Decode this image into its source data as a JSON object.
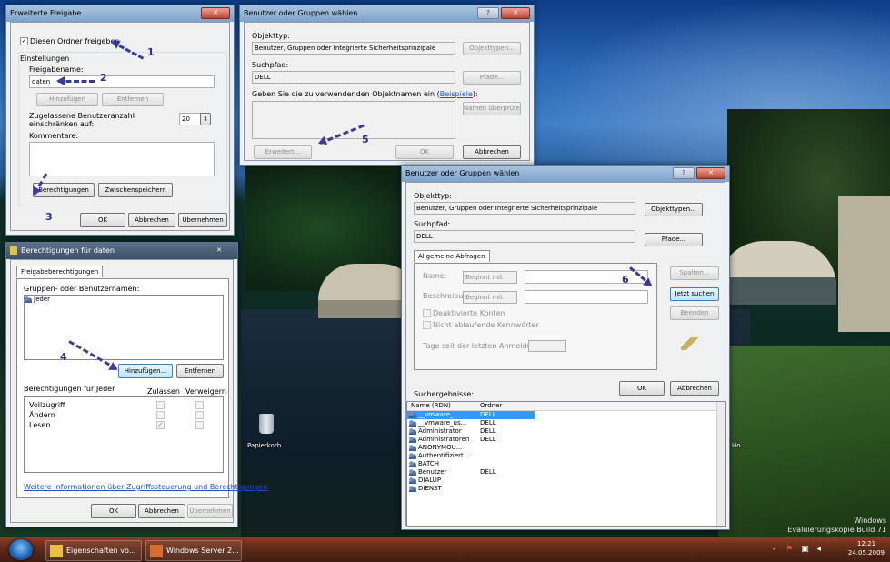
{
  "desktop": {
    "watermark_line1": "Windows",
    "watermark_line2": "Evaluierungskopie Build 71",
    "recycle_bin_label": "Papierkorb",
    "ho_label": "Ho..."
  },
  "win_freigabe": {
    "title": "Erweiterte Freigabe",
    "share_checkbox_label": "Diesen Ordner freigeben",
    "share_checked": true,
    "settings_group": "Einstellungen",
    "share_name_label": "Freigabename:",
    "share_name_value": "daten",
    "add_button": "Hinzufügen",
    "remove_button": "Entfernen",
    "limit_label": "Zugelassene Benutzeranzahl einschränken auf:",
    "limit_value": "20",
    "comments_label": "Kommentare:",
    "permissions_button": "Berechtigungen",
    "caching_button": "Zwischenspeichern",
    "ok": "OK",
    "cancel": "Abbrechen",
    "apply": "Übernehmen"
  },
  "win_select_small": {
    "title": "Benutzer oder Gruppen wählen",
    "object_type_label": "Objekttyp:",
    "object_type_value": "Benutzer, Gruppen oder Integrierte Sicherheitsprinzipale",
    "object_types_button": "Objekttypen...",
    "location_label": "Suchpfad:",
    "location_value": "DELL",
    "paths_button": "Pfade...",
    "names_label": "Geben Sie die zu verwendenden Objektnamen ein",
    "names_link": "Beispiele",
    "check_names_button": "Namen überprüfen",
    "advanced_button": "Erweitert...",
    "ok": "OK",
    "cancel": "Abbrechen"
  },
  "win_permissions": {
    "title": "Berechtigungen für daten",
    "tab": "Freigabeberechtigungen",
    "group_users_label": "Gruppen- oder Benutzernamen:",
    "users": [
      "Jeder"
    ],
    "add_button": "Hinzufügen...",
    "remove_button": "Entfernen",
    "perm_for_label": "Berechtigungen für Jeder",
    "col_allow": "Zulassen",
    "col_deny": "Verweigern",
    "perms": [
      {
        "name": "Vollzugriff",
        "allow": false,
        "deny": false
      },
      {
        "name": "Ändern",
        "allow": false,
        "deny": false
      },
      {
        "name": "Lesen",
        "allow": true,
        "deny": false
      }
    ],
    "info_link": "Weitere Informationen über Zugriffssteuerung und Berechtigungen",
    "ok": "OK",
    "cancel": "Abbrechen",
    "apply": "Übernehmen"
  },
  "win_select_large": {
    "title": "Benutzer oder Gruppen wählen",
    "object_type_label": "Objekttyp:",
    "object_type_value": "Benutzer, Gruppen oder Integrierte Sicherheitsprinzipale",
    "object_types_button": "Objekttypen...",
    "location_label": "Suchpfad:",
    "location_value": "DELL",
    "paths_button": "Pfade...",
    "tab": "Allgemeine Abfragen",
    "name_label": "Name:",
    "name_op": "Beginnt mit",
    "desc_label": "Beschreibung:",
    "desc_op": "Beginnt mit",
    "disabled_accounts": "Deaktivierte Konten",
    "non_expiring": "Nicht ablaufende Kennwörter",
    "days_label": "Tage seit der letzten Anmeldung:",
    "columns_button": "Spalten...",
    "search_now_button": "Jetzt suchen",
    "stop_button": "Beenden",
    "ok": "OK",
    "cancel": "Abbrechen",
    "results_label": "Suchergebnisse:",
    "col_name": "Name (RDN)",
    "col_folder": "Ordner",
    "results": [
      {
        "name": "__vmware_",
        "folder": "DELL",
        "selected": true
      },
      {
        "name": "__vmware_us...",
        "folder": "DELL",
        "selected": false
      },
      {
        "name": "Administrator",
        "folder": "DELL",
        "selected": false
      },
      {
        "name": "Administratoren",
        "folder": "DELL",
        "selected": false
      },
      {
        "name": "ANONYMOU...",
        "folder": "",
        "selected": false
      },
      {
        "name": "Authentifiziert...",
        "folder": "",
        "selected": false
      },
      {
        "name": "BATCH",
        "folder": "",
        "selected": false
      },
      {
        "name": "Benutzer",
        "folder": "DELL",
        "selected": false
      },
      {
        "name": "DIALUP",
        "folder": "",
        "selected": false
      },
      {
        "name": "DIENST",
        "folder": "",
        "selected": false
      }
    ]
  },
  "annotations": [
    "1",
    "2",
    "3",
    "4",
    "5",
    "6"
  ],
  "taskbar": {
    "items": [
      "Eigenschaften vo...",
      "Windows Server 2..."
    ],
    "time": "12:21",
    "date": "24.05.2009"
  },
  "colors": {
    "selection": "#3399ff",
    "annotation_arrow": "#3b3a9a",
    "taskbar": "#5e2a18"
  }
}
